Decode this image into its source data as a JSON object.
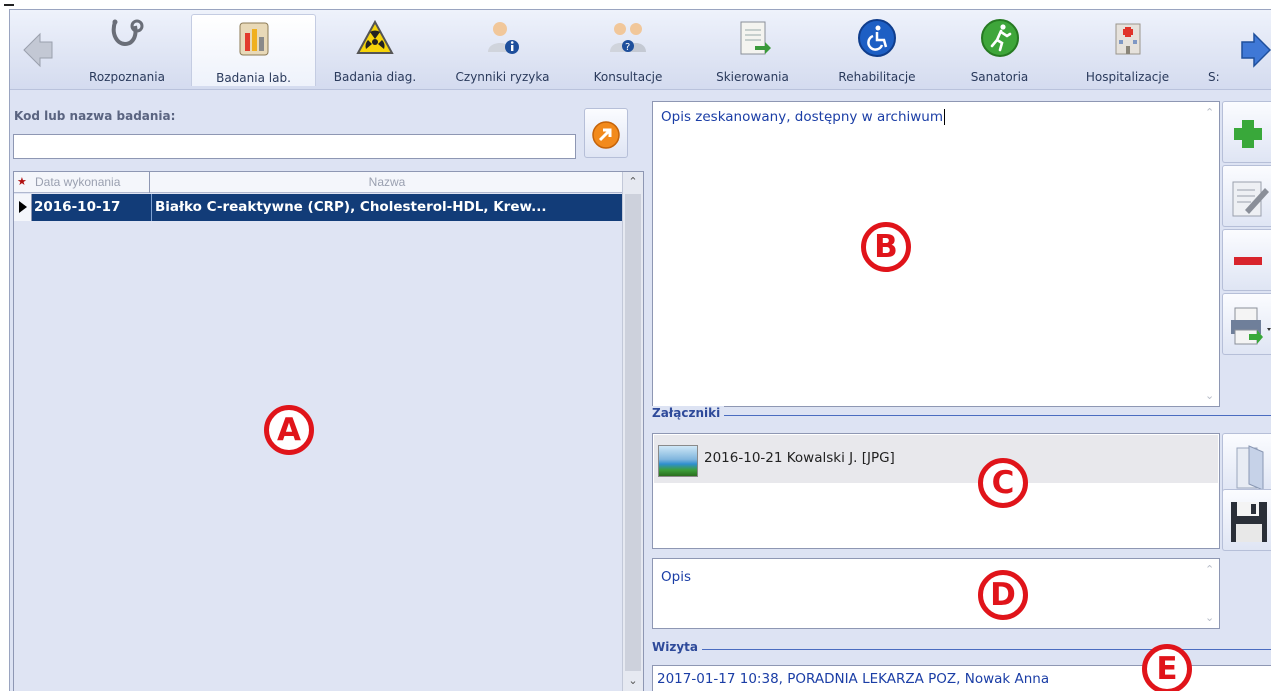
{
  "toolbar": {
    "buttons": [
      {
        "label": "Rozpoznania",
        "icon": "stethoscope-icon"
      },
      {
        "label": "Badania lab.",
        "icon": "lab-tubes-icon",
        "active": true
      },
      {
        "label": "Badania diag.",
        "icon": "radiation-warning-icon"
      },
      {
        "label": "Czynniki ryzyka",
        "icon": "person-info-icon"
      },
      {
        "label": "Konsultacje",
        "icon": "doctors-question-icon"
      },
      {
        "label": "Skierowania",
        "icon": "referral-document-icon"
      },
      {
        "label": "Rehabilitacje",
        "icon": "wheelchair-icon"
      },
      {
        "label": "Sanatoria",
        "icon": "running-man-icon"
      },
      {
        "label": "Hospitalizacje",
        "icon": "hospital-building-icon"
      },
      {
        "label": "S:",
        "icon": ""
      }
    ]
  },
  "search": {
    "label": "Kod lub nazwa badania:",
    "value": ""
  },
  "grid": {
    "columns": [
      "Data wykonania",
      "Nazwa"
    ],
    "rows": [
      {
        "date": "2016-10-17",
        "name": "Białko C-reaktywne (CRP), Cholesterol-HDL, Krew..."
      }
    ]
  },
  "description": {
    "text": "Opis zeskanowany, dostępny w archiwum"
  },
  "attachments": {
    "label": "Załączniki",
    "items": [
      {
        "text": "2016-10-21 Kowalski J. [JPG]"
      }
    ]
  },
  "attachment_description": {
    "text": "Opis"
  },
  "visit": {
    "label": "Wizyta",
    "text": "2017-01-17 10:38, PORADNIA LEKARZA POZ, Nowak Anna"
  },
  "callouts": {
    "a": "A",
    "b": "B",
    "c": "C",
    "d": "D",
    "e": "E"
  },
  "colors": {
    "panel_bg": "#dde3f3",
    "selection": "#123c78",
    "text_blue": "#1b3ea6",
    "callout_red": "#e0141a"
  }
}
